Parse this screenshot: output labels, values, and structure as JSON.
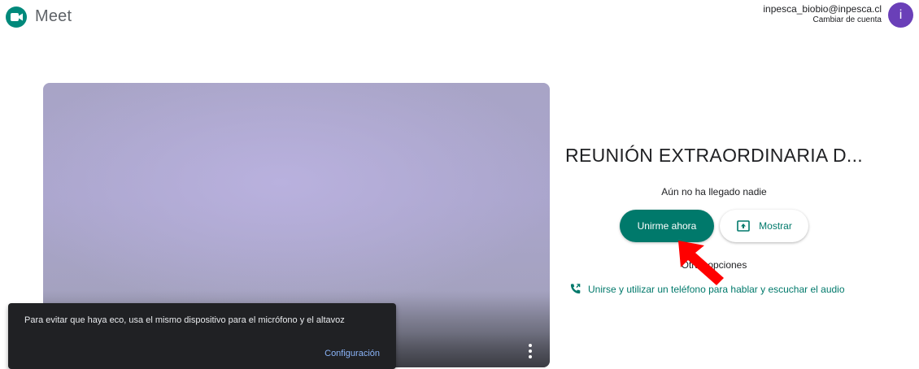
{
  "header": {
    "app_name": "Meet",
    "account_email": "inpesca_biobio@inpesca.cl",
    "switch_account": "Cambiar de cuenta",
    "avatar_initial": "i",
    "avatar_color": "#6a3fb8"
  },
  "preview": {
    "more_options_icon": "more-vert-icon"
  },
  "meeting": {
    "title": "REUNIÓN EXTRAORDINARIA D...",
    "status": "Aún no ha llegado nadie",
    "join_label": "Unirme ahora",
    "present_label": "Mostrar",
    "present_icon": "present-screen-icon",
    "other_options": "Otras opciones",
    "phone_option": "Unirse y utilizar un teléfono para hablar y escuchar el audio",
    "phone_icon": "phone-icon",
    "accent_color": "#00796b"
  },
  "toast": {
    "message": "Para evitar que haya eco, usa el mismo dispositivo para el micrófono y el altavoz",
    "action_label": "Configuración"
  },
  "annotation": {
    "arrow_color": "#ff0000"
  }
}
